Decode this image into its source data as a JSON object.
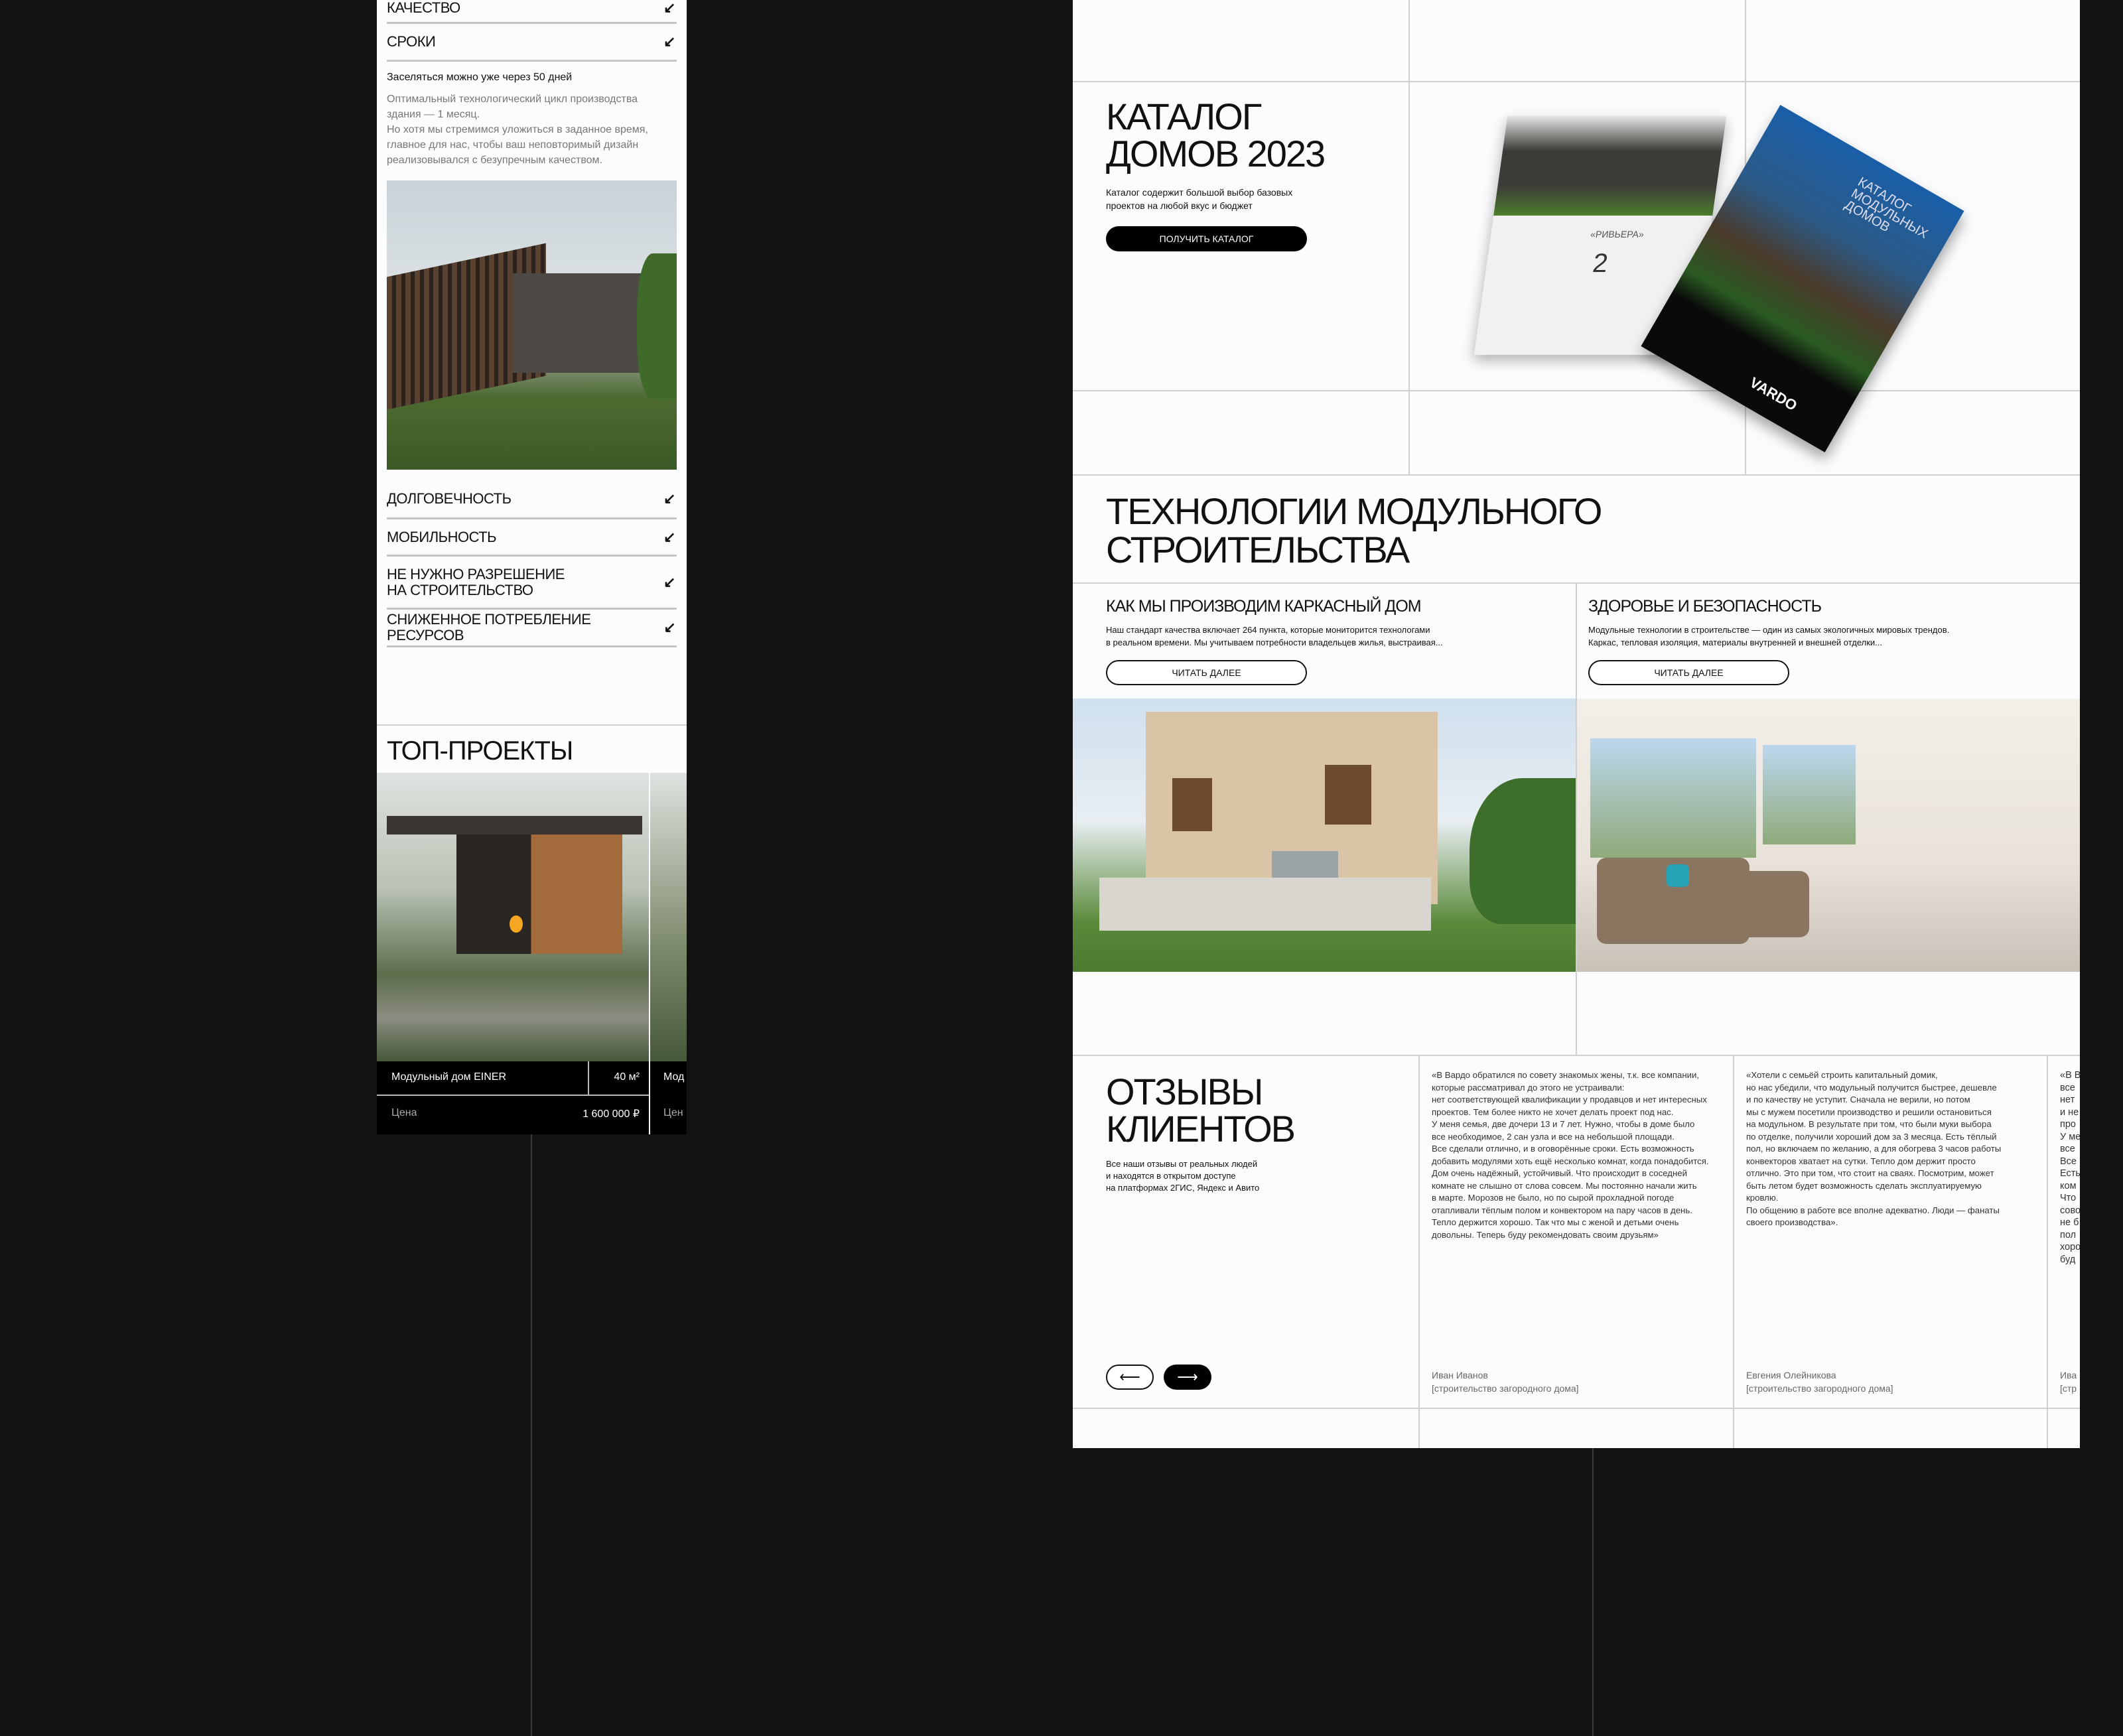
{
  "mobile": {
    "accordion_top": [
      {
        "label": "КАЧЕСТВО"
      },
      {
        "label": "СРОКИ"
      }
    ],
    "expanded": {
      "lead": "Заселяться можно уже через 50 дней",
      "text": "Оптимальный технологический цикл производства\nздания — 1 месяц.\nНо хотя мы стремимся уложиться в заданное время,\nглавное для нас, чтобы ваш неповторимый дизайн\nреализовывался с безупречным качеством."
    },
    "accordion_bottom": [
      {
        "label": "ДОЛГОВЕЧНОСТЬ"
      },
      {
        "label": "МОБИЛЬНОСТЬ"
      },
      {
        "label": "НЕ НУЖНО РАЗРЕШЕНИЕ\nНА СТРОИТЕЛЬСТВО"
      },
      {
        "label": "СНИЖЕННОЕ ПОТРЕБЛЕНИЕ РЕСУРСОВ"
      }
    ],
    "arrow_icon": "↙",
    "top_projects": {
      "title": "ТОП-ПРОЕКТЫ",
      "cards": [
        {
          "name": "Модульный дом EINER",
          "area": "40 м²",
          "price_label": "Цена",
          "price": "1 600 000 ₽"
        },
        {
          "name": "Мод",
          "price_label": "Цен"
        }
      ]
    }
  },
  "desktop": {
    "catalog": {
      "title_line1": "КАТАЛОГ",
      "title_line2": "ДОМОВ 2023",
      "subtitle": "Каталог содержит большой выбор базовых\nпроектов на любой вкус и бюджет",
      "button": "ПОЛУЧИТЬ КАТАЛОГ",
      "book_cover_text": "КАТАЛОГ МОДУЛЬНЫХ ДОМОВ",
      "book_page_title": "«РИВЬЕРА»",
      "book_page_number": "2",
      "brand": "VARDO"
    },
    "tech": {
      "title": "ТЕХНОЛОГИИ МОДУЛЬНОГО\nСТРОИТЕЛЬСТВА",
      "cards": [
        {
          "title": "КАК МЫ ПРОИЗВОДИМ КАРКАСНЫЙ ДОМ",
          "text": "Наш стандарт качества включает 264 пункта, которые мониторится технологами\nв реальном времени. Мы учитываем потребности владельцев жилья, выстраивая...",
          "button": "ЧИТАТЬ ДАЛЕЕ"
        },
        {
          "title": "ЗДОРОВЬЕ И БЕЗОПАСНОСТЬ",
          "text": "Модульные технологии в строительстве — один из самых экологичных мировых трендов.\nКаркас, тепловая изоляция, материалы внутренней и внешней отделки...",
          "button": "ЧИТАТЬ ДАЛЕЕ"
        }
      ]
    },
    "reviews": {
      "title": "ОТЗЫВЫ\nКЛИЕНТОВ",
      "subtitle": "Все наши отзывы от реальных людей\nи находятся в открытом доступе\nна платформах 2ГИС, Яндекс и Авито",
      "prev_icon": "⟵",
      "next_icon": "⟶",
      "items": [
        {
          "text": "«В Вардо обратился по совету знакомых жены, т.к. все компании,\nкоторые рассматривал до этого не устраивали:\nнет соответствующей квалификации у продавцов и нет интересных\nпроектов. Тем более никто не хочет делать проект под нас.\nУ меня семья, две дочери 13 и 7 лет. Нужно, чтобы в доме было\nвсе необходимое, 2 сан узла и все на небольшой площади.\nВсе сделали отлично, и в оговорённые сроки. Есть возможность\nдобавить модулями хоть ещё несколько комнат, когда понадобится.\nДом очень надёжный, устойчивый. Что происходит в соседней\nкомнате не слышно от слова совсем. Мы постоянно начали жить\nв марте. Морозов не было, но по сырой прохладной погоде\nотапливали тёплым полом и конвектором на пару часов в день.\nТепло держится хорошо. Так что мы с женой и детьми очень\nдовольны. Теперь буду рекомендовать своим друзьям»",
          "author": "Иван Иванов",
          "tag": "[строительство загородного дома]"
        },
        {
          "text": "«Хотели с семьёй строить капитальный домик,\nно нас убедили, что модульный получится быстрее, дешевле\nи по качеству не уступит. Сначала не верили, но потом\nмы с мужем посетили производство и решили остановиться\nна модульном. В результате при том, что были муки выбора\nпо отделке, получили хороший дом за 3 месяца. Есть тёплый\nпол, но включаем по желанию, а для обогрева 3 часов работы\nконвекторов хватает на сутки. Тепло дом держит просто\nотлично. Это при том, что стоит на сваях. Посмотрим, может\nбыть летом будет возможность сделать эксплуатируемую\nкровлю.\nПо общению в работе все вполне адекватно. Люди — фанаты\nсвоего производства».",
          "author": "Евгения Олейникова",
          "tag": "[строительство загородного дома]"
        },
        {
          "text": "«В В\nвсе\nнет\nи не\nпро\nУ ме\nвсе\nВсе\nЕсть\nком\nЧто\nсово\nне б\nпол\nхоро\nбуд",
          "author": "Ива",
          "tag": "[стр"
        }
      ]
    }
  }
}
